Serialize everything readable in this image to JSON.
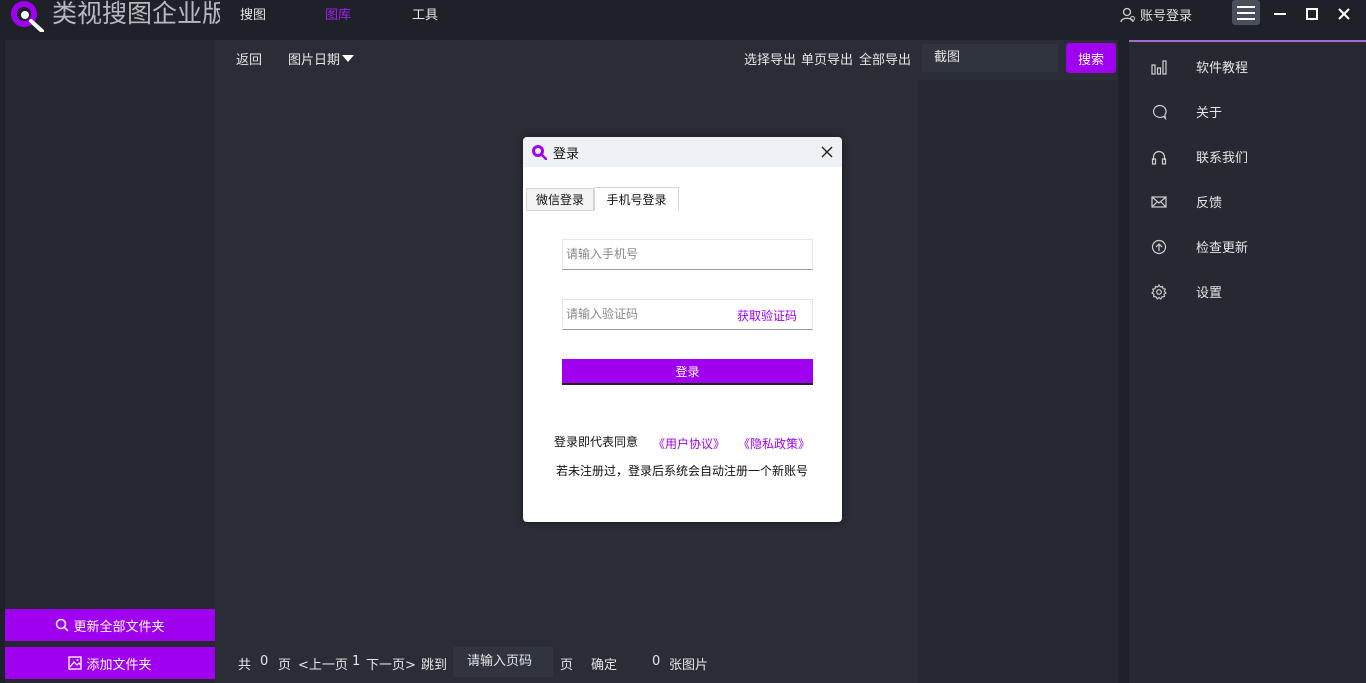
{
  "app": {
    "title": "类视搜图企业版",
    "brand_color": "#a000f0"
  },
  "nav": {
    "tabs": [
      {
        "label": "搜图",
        "active": false
      },
      {
        "label": "图库",
        "active": true
      },
      {
        "label": "工具",
        "active": false
      }
    ]
  },
  "header": {
    "account_label": "账号登录"
  },
  "left": {
    "refresh_all_label": "更新全部文件夹",
    "add_folder_label": "添加文件夹"
  },
  "toolbar": {
    "back_label": "返回",
    "date_label": "图片日期",
    "select_export_label": "选择导出",
    "page_export_label": "单页导出",
    "all_export_label": "全部导出",
    "search_value": "截图",
    "search_label": "搜索"
  },
  "pager": {
    "total_prefix": "共",
    "total_pages": "0",
    "page_unit": "页",
    "prev_label": "<上一页",
    "current_page": "1",
    "next_label": "下一页>",
    "jump_label": "跳到",
    "page_input_placeholder": "请输入页码",
    "page_unit2": "页",
    "confirm_label": "确定",
    "image_count": "0",
    "image_unit": "张图片"
  },
  "menu": {
    "items": [
      {
        "label": "软件教程",
        "icon": "chart-icon"
      },
      {
        "label": "关于",
        "icon": "chat-icon"
      },
      {
        "label": "联系我们",
        "icon": "headset-icon"
      },
      {
        "label": "反馈",
        "icon": "mail-icon"
      },
      {
        "label": "检查更新",
        "icon": "upload-icon"
      },
      {
        "label": "设置",
        "icon": "gear-icon"
      }
    ]
  },
  "dialog": {
    "title": "登录",
    "tabs": [
      {
        "label": "微信登录",
        "active": false
      },
      {
        "label": "手机号登录",
        "active": true
      }
    ],
    "phone_placeholder": "请输入手机号",
    "code_placeholder": "请输入验证码",
    "get_code_label": "获取验证码",
    "login_label": "登录",
    "agree_text": "登录即代表同意",
    "user_agreement": "《用户协议》",
    "privacy_policy": "《隐私政策》",
    "notice": "若未注册过，登录后系统会自动注册一个新账号"
  }
}
